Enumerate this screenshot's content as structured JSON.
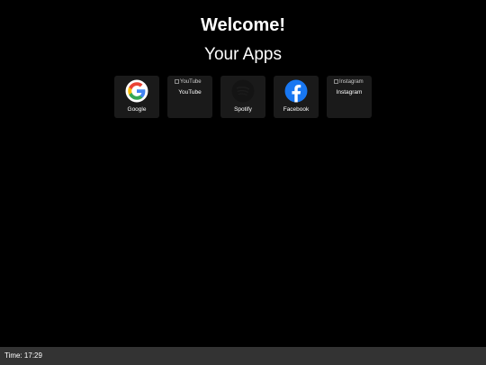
{
  "header": {
    "welcome": "Welcome!",
    "apps_heading": "Your Apps"
  },
  "apps": [
    {
      "name": "Google",
      "icon": "google-logo-icon",
      "image_loaded": true
    },
    {
      "name": "YouTube",
      "alt": "YouTube",
      "icon": "broken-image-icon",
      "image_loaded": false
    },
    {
      "name": "Spotify",
      "icon": "spotify-logo-icon",
      "image_loaded": true
    },
    {
      "name": "Facebook",
      "icon": "facebook-logo-icon",
      "image_loaded": true
    },
    {
      "name": "Instagram",
      "alt": "Instagram",
      "icon": "broken-image-icon",
      "image_loaded": false
    }
  ],
  "status_bar": {
    "time_text": "Time: 17:29"
  },
  "colors": {
    "background": "#000000",
    "tile": "#1a1a1a",
    "status_bar": "#333333",
    "facebook_blue": "#1877F2",
    "google_blue": "#4285F4",
    "google_red": "#EA4335",
    "google_yellow": "#FBBC05",
    "google_green": "#34A853"
  }
}
